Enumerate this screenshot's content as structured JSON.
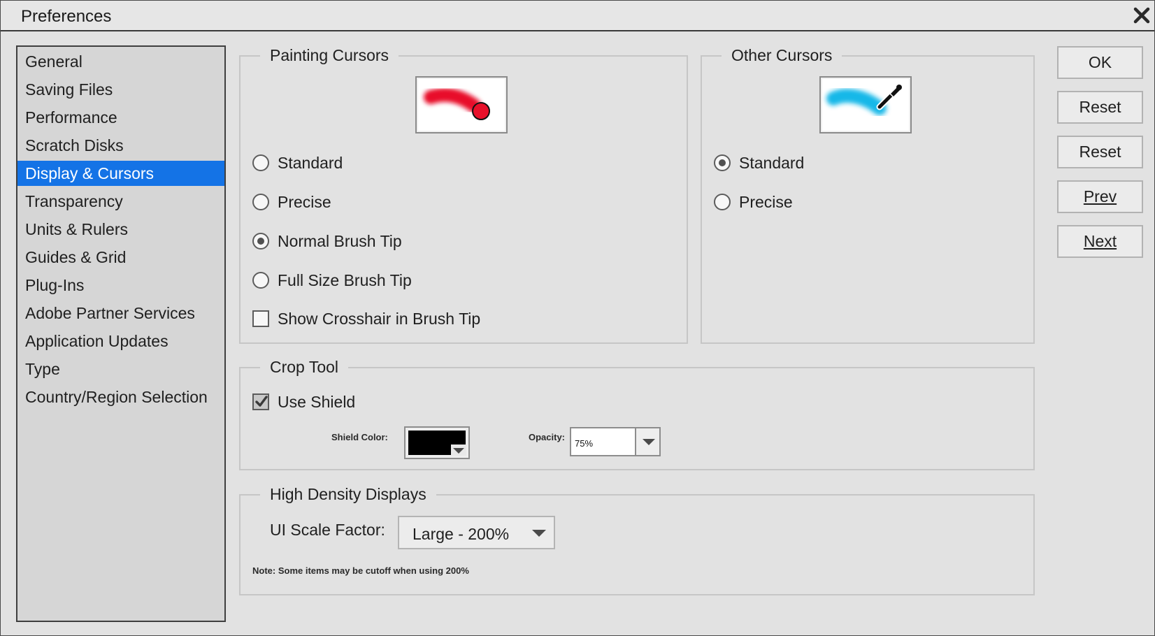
{
  "window": {
    "title": "Preferences"
  },
  "sidebar": {
    "items": [
      {
        "label": "General"
      },
      {
        "label": "Saving Files"
      },
      {
        "label": "Performance"
      },
      {
        "label": "Scratch Disks"
      },
      {
        "label": "Display & Cursors",
        "selected": true
      },
      {
        "label": "Transparency"
      },
      {
        "label": "Units & Rulers"
      },
      {
        "label": "Guides & Grid"
      },
      {
        "label": "Plug-Ins"
      },
      {
        "label": "Adobe Partner Services"
      },
      {
        "label": "Application Updates"
      },
      {
        "label": "Type"
      },
      {
        "label": "Country/Region Selection"
      }
    ]
  },
  "painting_cursors": {
    "title": "Painting Cursors",
    "options": {
      "standard": {
        "label": "Standard",
        "checked": false
      },
      "precise": {
        "label": "Precise",
        "checked": false
      },
      "normal_tip": {
        "label": "Normal Brush Tip",
        "checked": true
      },
      "full_tip": {
        "label": "Full Size Brush Tip",
        "checked": false
      }
    },
    "crosshair": {
      "label": "Show Crosshair in Brush Tip",
      "checked": false
    },
    "preview_color": "#e8102a"
  },
  "other_cursors": {
    "title": "Other Cursors",
    "options": {
      "standard": {
        "label": "Standard",
        "checked": true
      },
      "precise": {
        "label": "Precise",
        "checked": false
      }
    },
    "preview_color": "#18b8e8"
  },
  "crop_tool": {
    "title": "Crop Tool",
    "use_shield": {
      "label": "Use Shield",
      "checked": true
    },
    "shield_color_label": "Shield Color:",
    "shield_color": "#000000",
    "opacity_label": "Opacity:",
    "opacity_value": "75%"
  },
  "high_density": {
    "title": "High Density Displays",
    "scale_label": "UI Scale Factor:",
    "scale_value": "Large - 200%",
    "note": "Note: Some items may be cutoff when using 200%"
  },
  "buttons": {
    "ok": "OK",
    "reset1": "Reset",
    "reset2": "Reset",
    "prev": "Prev",
    "next": "Next"
  },
  "icons": {
    "close": "close-x-icon",
    "eyedropper": "eyedropper-icon"
  },
  "colors": {
    "selection": "#1473e6"
  }
}
